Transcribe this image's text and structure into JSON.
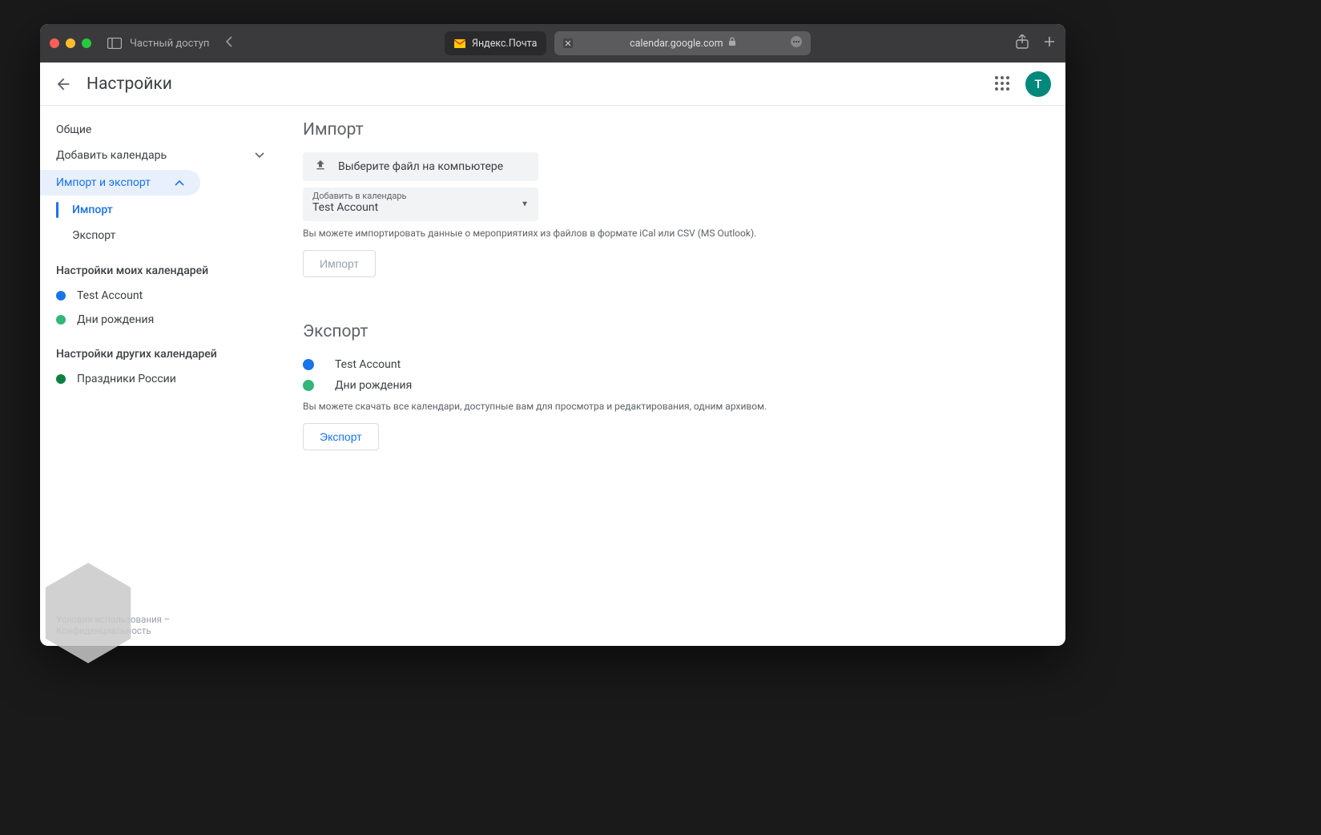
{
  "browser": {
    "private_label": "Частный доступ",
    "tabs": [
      {
        "label": "Яндекс.Почта"
      },
      {
        "label": "calendar.google.com"
      }
    ]
  },
  "header": {
    "title": "Настройки",
    "avatar_initial": "T"
  },
  "sidebar": {
    "general": "Общие",
    "add_calendar": "Добавить календарь",
    "import_export": "Импорт и экспорт",
    "sub": {
      "import": "Импорт",
      "export": "Экспорт"
    },
    "my_cal_heading": "Настройки моих календарей",
    "my_calendars": [
      {
        "label": "Test Account",
        "color": "#1a73e8"
      },
      {
        "label": "Дни рождения",
        "color": "#33b679"
      }
    ],
    "other_cal_heading": "Настройки других календарей",
    "other_calendars": [
      {
        "label": "Праздники России",
        "color": "#0b8043"
      }
    ]
  },
  "import_section": {
    "title": "Импорт",
    "file_picker_label": "Выберите файл на компьютере",
    "select_label": "Добавить в календарь",
    "select_value": "Test Account",
    "help": "Вы можете импортировать данные о мероприятиях из файлов в формате iCal или CSV (MS Outlook).",
    "button": "Импорт"
  },
  "export_section": {
    "title": "Экспорт",
    "calendars": [
      {
        "label": "Test Account",
        "color": "#1a73e8"
      },
      {
        "label": "Дни рождения",
        "color": "#33b679"
      }
    ],
    "help": "Вы можете скачать все календари, доступные вам для просмотра и редактирования, одним архивом.",
    "button": "Экспорт"
  },
  "footer": {
    "terms": "Условия использования",
    "privacy": "Конфиденциальность"
  }
}
